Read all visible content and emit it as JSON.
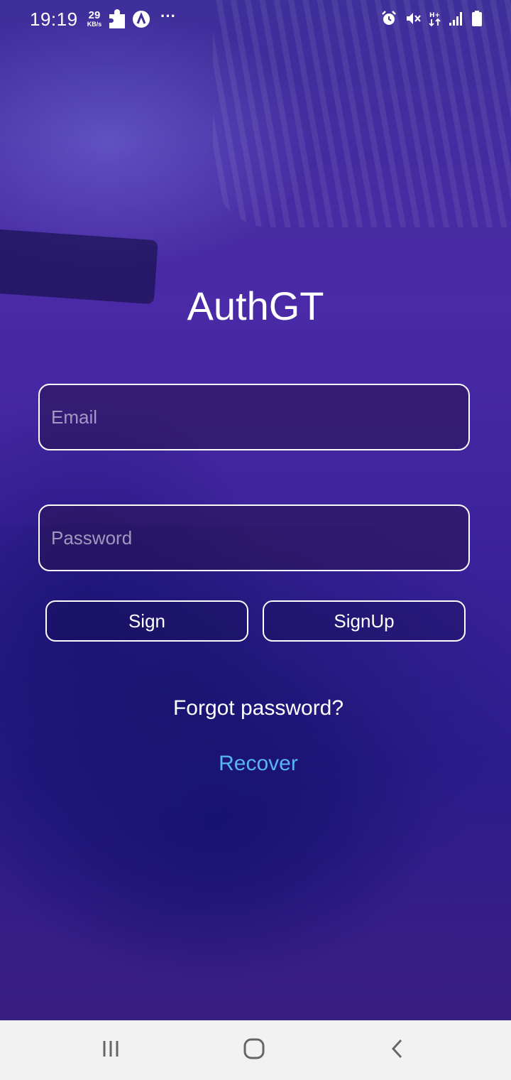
{
  "status_bar": {
    "time": "19:19",
    "speed_value": "29",
    "speed_unit": "KB/s",
    "icons": [
      "puzzle-icon",
      "app-logo-icon",
      "more-dots-icon",
      "alarm-icon",
      "mute-icon",
      "data-transfer-icon",
      "signal-icon",
      "battery-icon"
    ],
    "more": "···"
  },
  "app": {
    "title": "AuthGT"
  },
  "form": {
    "email_placeholder": "Email",
    "email_value": "",
    "password_placeholder": "Password",
    "password_value": "",
    "sign_label": "Sign",
    "signup_label": "SignUp",
    "forgot_text": "Forgot password?",
    "recover_label": "Recover"
  },
  "colors": {
    "link": "#58b4f6",
    "background": "#3b1f86",
    "nav_bar": "#f2f2f2"
  },
  "nav_bar": {
    "icons": [
      "recent-apps-icon",
      "home-icon",
      "back-icon"
    ]
  }
}
